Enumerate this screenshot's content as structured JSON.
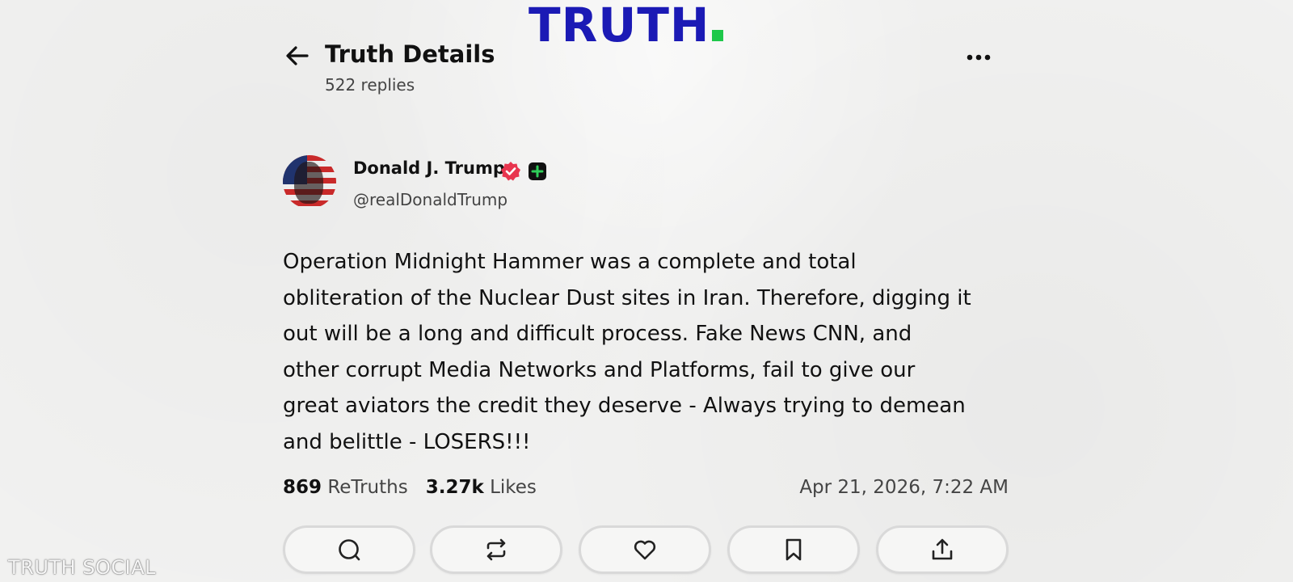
{
  "brand": {
    "logo_text": "TRUTH",
    "dot_color": "#1ec84a",
    "logo_color": "#1b1ab5"
  },
  "header": {
    "back_icon": "arrow-left-icon",
    "title": "Truth Details",
    "reply_count": "522 replies",
    "menu_icon": "more-horizontal-icon"
  },
  "post": {
    "author_name": "Donald J. Trump",
    "handle": "@realDonaldTrump",
    "verified_badge_color": "#e8354f",
    "body_lines": [
      "Operation Midnight Hammer was a complete and total",
      "obliteration of the Nuclear Dust sites in Iran. Therefore, digging it",
      "out will be a long and difficult process. Fake News CNN, and",
      "other corrupt Media Networks and Platforms, fail to give our",
      "great aviators the credit they deserve - Always trying to demean",
      "and belittle - LOSERS!!!"
    ],
    "retruths_count": "869",
    "retruths_label": "ReTruths",
    "likes_count": "3.27k",
    "likes_label": "Likes",
    "timestamp": "Apr 21, 2026, 7:22 AM"
  },
  "actions": [
    {
      "icon": "reply-icon"
    },
    {
      "icon": "retruth-icon"
    },
    {
      "icon": "like-heart-icon"
    },
    {
      "icon": "bookmark-icon"
    },
    {
      "icon": "share-icon"
    }
  ],
  "watermark": "TRUTH SOCIAL"
}
